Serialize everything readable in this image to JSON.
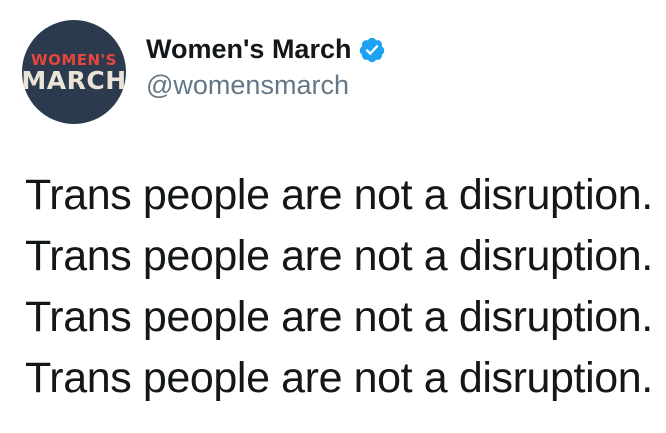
{
  "author": {
    "avatar_line1": "WOMEN'S",
    "avatar_line2": "MARCH",
    "display_name": "Women's March",
    "handle": "@womensmarch",
    "verified": true,
    "verified_icon": "verified-badge-icon"
  },
  "tweet": {
    "lines": [
      "Trans people are not a disruption.",
      "Trans people are not a disruption.",
      "Trans people are not a disruption.",
      "Trans people are not a disruption."
    ]
  },
  "colors": {
    "avatar_bg": "#2b3a4d",
    "avatar_accent": "#e8453c",
    "avatar_text": "#e9e4d6",
    "verified_blue": "#1da1f2",
    "handle_gray": "#657786",
    "text": "#14171a"
  }
}
